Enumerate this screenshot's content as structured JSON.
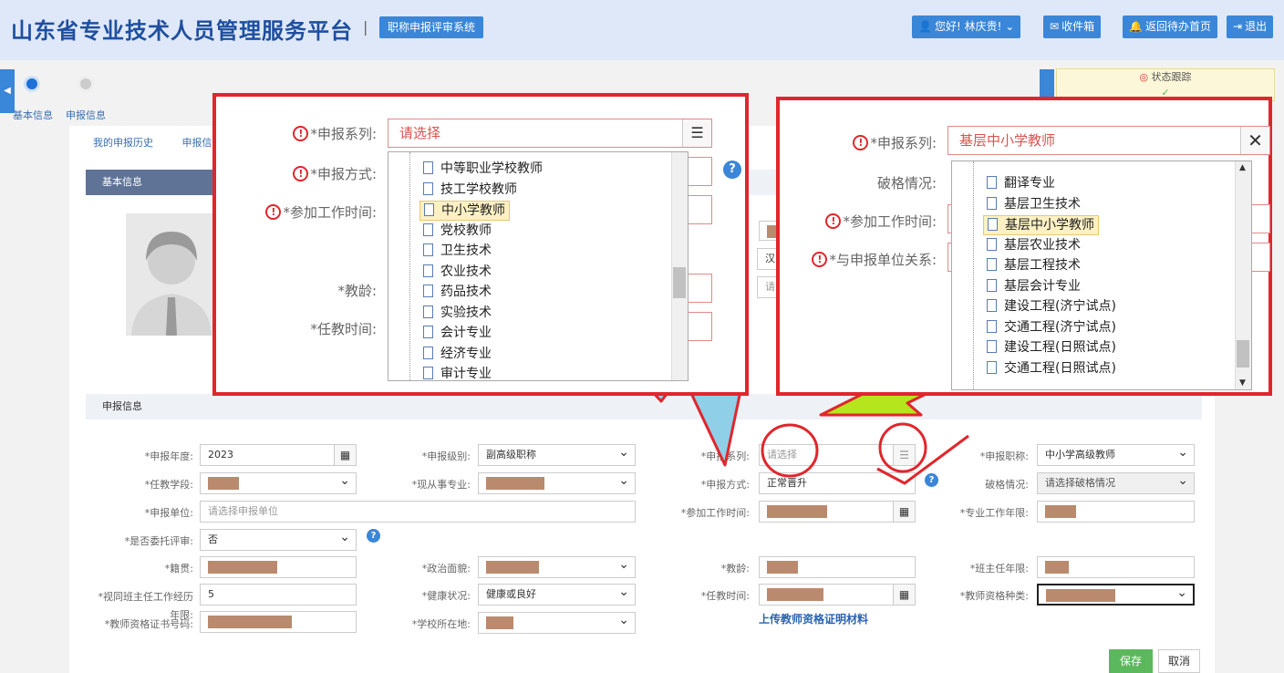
{
  "header": {
    "title": "山东省专业技术人员管理服务平台",
    "separator": "|",
    "subsystem": "职称申报评审系统",
    "user_greeting": "您好! 林庆贵!",
    "inbox": "收件箱",
    "back_home": "返回待办首页",
    "logout": "退出"
  },
  "steps": {
    "step1": "基本信息",
    "step2": "申报信息"
  },
  "status_tracking": "状态跟踪",
  "tabs": {
    "history": "我的申报历史",
    "apply": "申报信"
  },
  "sections": {
    "basic": "基本信息",
    "apply": "申报信息"
  },
  "bg_fields": {
    "ethnicity_prefix": "汉",
    "hint_prefix": "请"
  },
  "form": {
    "year_label": "*申报年度:",
    "year_value": "2023",
    "level_label": "*申报级别:",
    "level_value": "副高级职称",
    "series_label": "*申报系列:",
    "series_value": "请选择",
    "title_label": "*申报职称:",
    "title_value": "中小学高级教师",
    "stage_label": "*任教学段:",
    "major_label": "*现从事专业:",
    "method_label": "*申报方式:",
    "method_value": "正常晋升",
    "breaking_label": "破格情况:",
    "breaking_value": "请选择破格情况",
    "unit_label": "*申报单位:",
    "unit_placeholder": "请选择申报单位",
    "work_time_label": "*参加工作时间:",
    "pro_years_label": "*专业工作年限:",
    "entrust_label": "*是否委托评审:",
    "entrust_value": "否",
    "native_label": "*籍贯:",
    "political_label": "*政治面貌:",
    "teach_age_label": "*教龄:",
    "head_years_label": "*班主任年限:",
    "equiv_label": "*视同班主任工作经历年限:",
    "equiv_value": "5",
    "health_label": "*健康状况:",
    "health_value": "健康或良好",
    "teach_time_label": "*任教时间:",
    "cert_type_label": "*教师资格种类:",
    "cert_no_label": "*教师资格证书号码:",
    "school_loc_label": "*学校所在地:",
    "upload_link": "上传教师资格证明材料",
    "save": "保存",
    "cancel": "取消"
  },
  "popup_left": {
    "series_label": "*申报系列:",
    "method_label": "*申报方式:",
    "work_time_label": "*参加工作时间:",
    "teach_age_label": "*教龄:",
    "teach_time_label": "*任教时间:",
    "series_value": "请选择",
    "items": [
      "中等职业学校教师",
      "技工学校教师",
      "中小学教师",
      "党校教师",
      "卫生技术",
      "农业技术",
      "药品技术",
      "实验技术",
      "会计专业",
      "经济专业",
      "审计专业"
    ],
    "selected_index": 2
  },
  "popup_right": {
    "series_label": "*申报系列:",
    "breaking_label": "破格情况:",
    "work_time_label": "*参加工作时间:",
    "relation_label": "*与申报单位关系:",
    "series_value": "基层中小学教师",
    "items": [
      "翻译专业",
      "基层卫生技术",
      "基层中小学教师",
      "基层农业技术",
      "基层工程技术",
      "基层会计专业",
      "建设工程(济宁试点)",
      "交通工程(济宁试点)",
      "建设工程(日照试点)",
      "交通工程(日照试点)"
    ],
    "selected_index": 2
  },
  "colors": {
    "brand": "#1e4fa0",
    "accent": "#3a86d8",
    "annotation_red": "#e0262c",
    "bolt_blue": "#8fd0e8",
    "bolt_green": "#b5e61d",
    "save_green": "#5cb85c"
  }
}
